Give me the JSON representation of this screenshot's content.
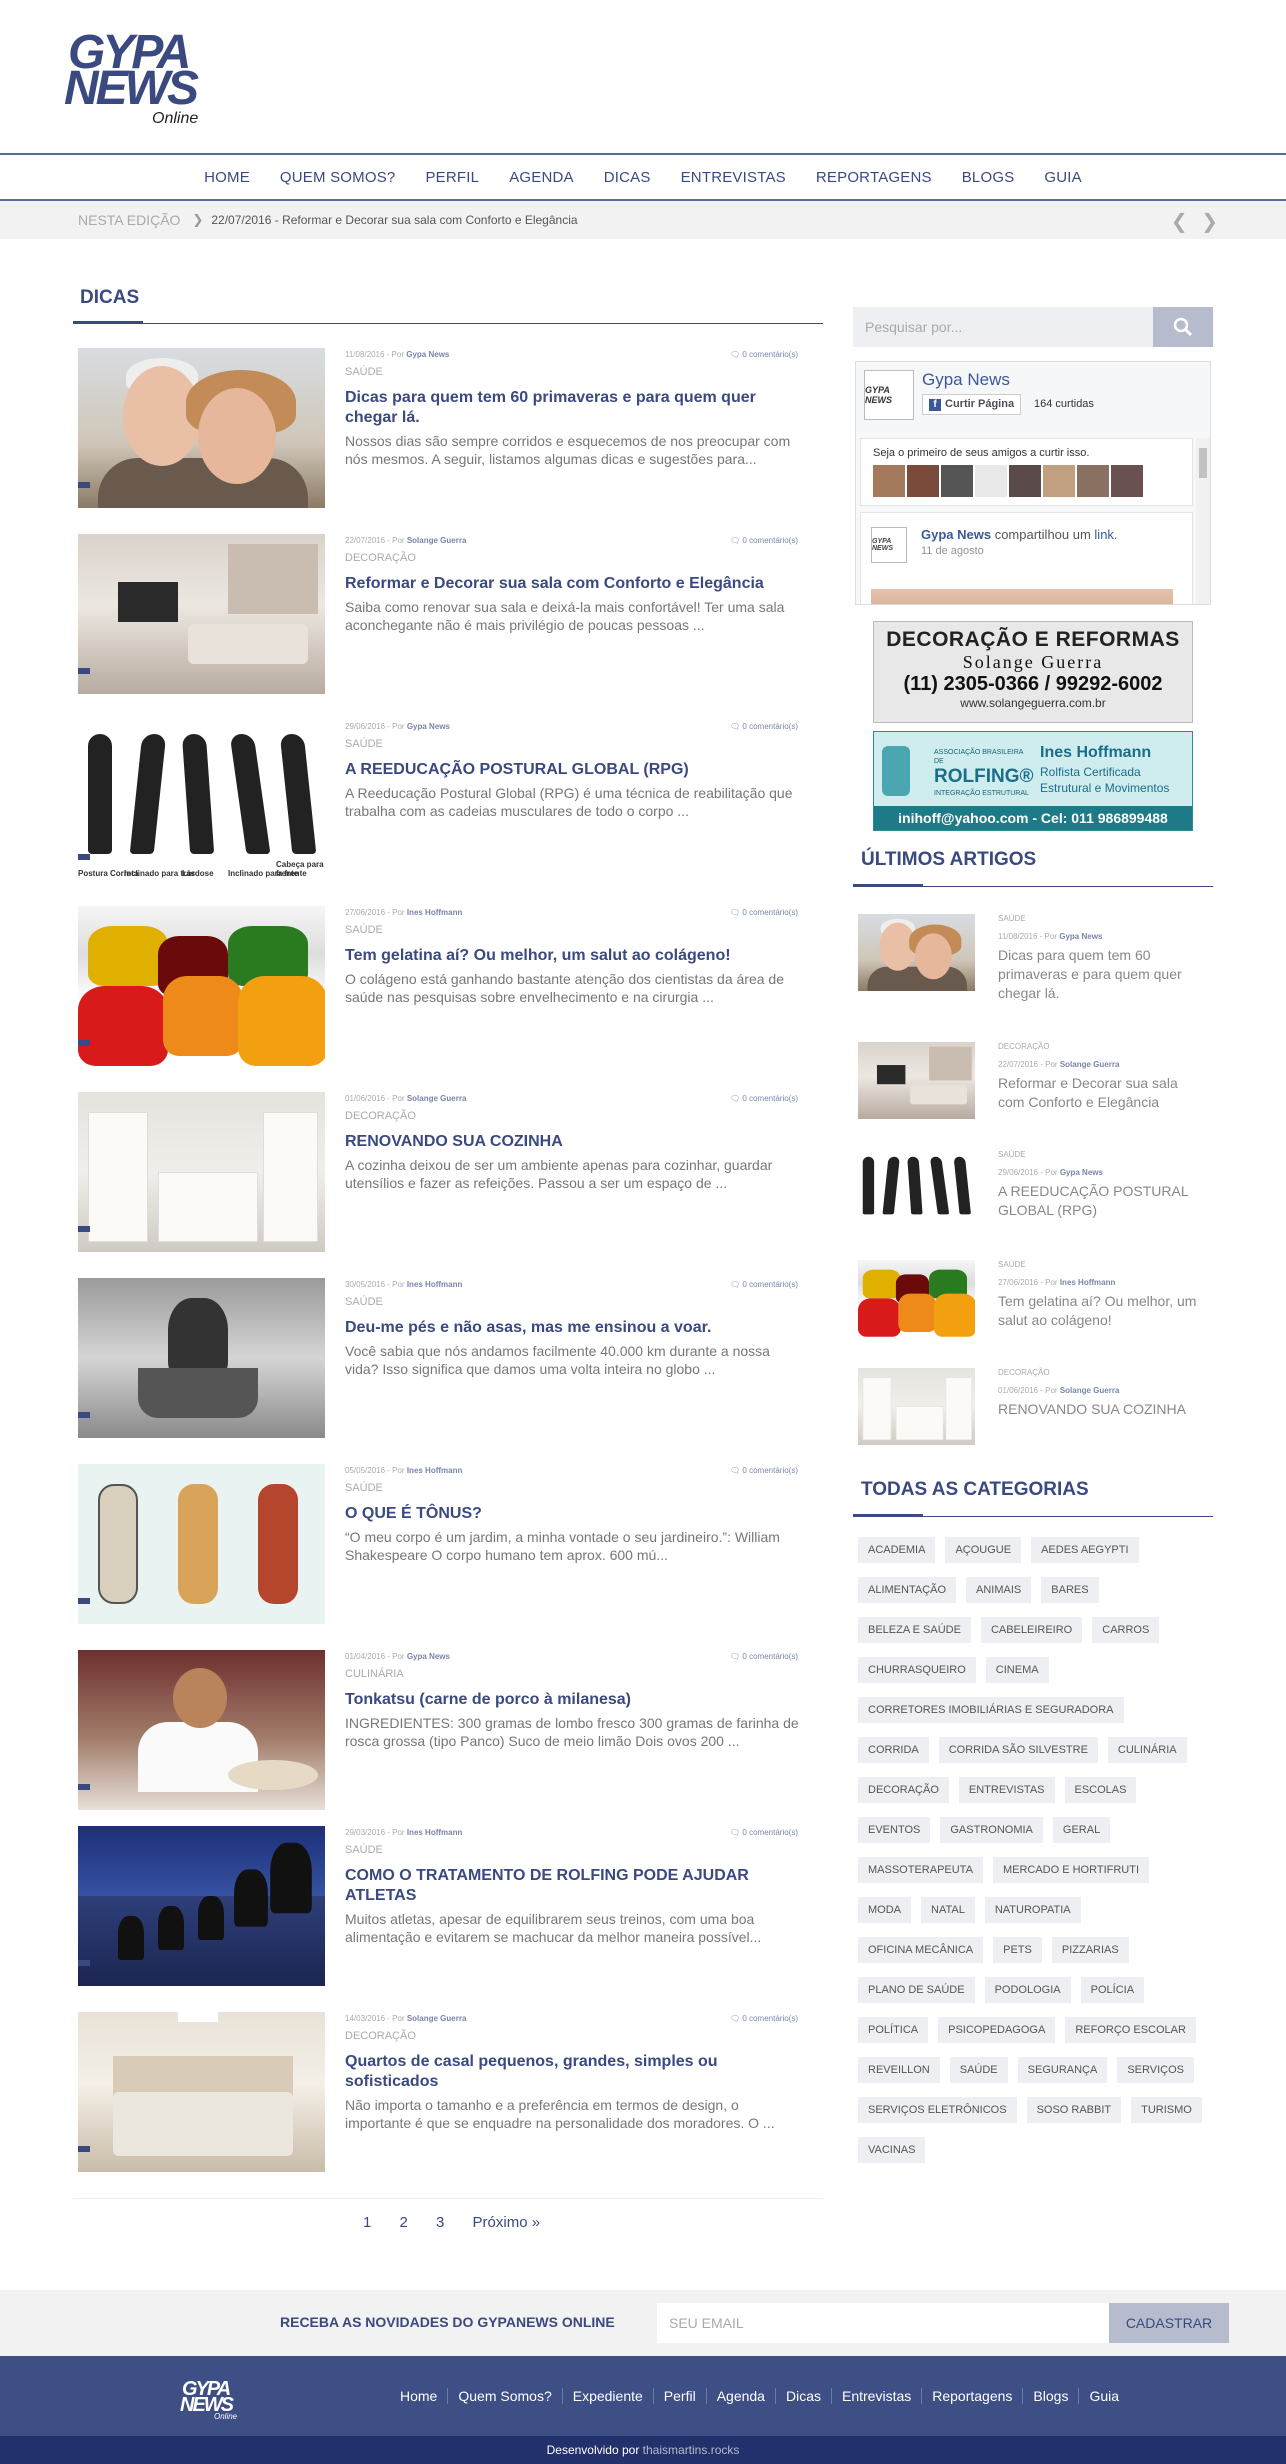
{
  "header": {
    "logo_line1": "GYPA",
    "logo_line2": "NEWS",
    "logo_line3": "Online"
  },
  "nav": [
    "HOME",
    "QUEM SOMOS?",
    "PERFIL",
    "AGENDA",
    "DICAS",
    "ENTREVISTAS",
    "REPORTAGENS",
    "BLOGS",
    "GUIA"
  ],
  "ticker": {
    "label": "NESTA EDIÇÃO",
    "text": "22/07/2016 - Reformar e Decorar sua sala com Conforto e Elegância",
    "arrows": "❮ ❯"
  },
  "main": {
    "section_title": "DICAS",
    "posts": [
      {
        "date": "11/08/2016 - Por ",
        "author": "Gypa News",
        "comments": "0 comentário(s)",
        "category": "SAÚDE",
        "title": "Dicas para quem tem 60 primaveras e para quem quer chegar lá.",
        "excerpt": "Nossos dias são sempre corridos e esquecemos de nos preocupar com nós mesmos. A seguir, listamos algumas dicas e sugestões para..."
      },
      {
        "date": "22/07/2016 - Por ",
        "author": "Solange Guerra",
        "comments": "0 comentário(s)",
        "category": "DECORAÇÃO",
        "title": "Reformar e Decorar sua sala com Conforto e Elegância",
        "excerpt": "Saiba como renovar sua sala e deixá-la mais confortável! Ter uma sala aconchegante não é mais privilégio de poucas pessoas ..."
      },
      {
        "date": "29/06/2016 - Por ",
        "author": "Gypa News",
        "comments": "0 comentário(s)",
        "category": "SAÚDE",
        "title": "A REEDUCAÇÃO POSTURAL GLOBAL (RPG)",
        "excerpt": "A Reeducação Postural Global (RPG) é uma técnica de reabilitação que trabalha com as cadeias musculares de todo o corpo ..."
      },
      {
        "date": "27/06/2016 - Por ",
        "author": "Ines Hoffmann",
        "comments": "0 comentário(s)",
        "category": "SAÚDE",
        "title": "Tem gelatina aí? Ou melhor, um salut ao colágeno!",
        "excerpt": "O colágeno está ganhando bastante atenção dos cientistas da área de saúde nas pesquisas sobre envelhecimento e na cirurgia ..."
      },
      {
        "date": "01/06/2016 - Por ",
        "author": "Solange Guerra",
        "comments": "0 comentário(s)",
        "category": "DECORAÇÃO",
        "title": "RENOVANDO SUA COZINHA",
        "excerpt": "A cozinha deixou de ser um ambiente apenas para cozinhar, guardar utensílios e fazer as refeições. Passou a ser um espaço de ..."
      },
      {
        "date": "30/05/2016 - Por ",
        "author": "Ines Hoffmann",
        "comments": "0 comentário(s)",
        "category": "SAÚDE",
        "title": "Deu-me pés e não asas, mas me ensinou a voar.",
        "excerpt": "Você sabia que nós andamos facilmente 40.000 km durante a nossa vida? Isso significa que damos uma volta inteira no globo ..."
      },
      {
        "date": "05/05/2016 - Por ",
        "author": "Ines Hoffmann",
        "comments": "0 comentário(s)",
        "category": "SAÚDE",
        "title": "O QUE É TÔNUS?",
        "excerpt": "“O meu corpo é um jardim, a minha vontade o seu jardineiro.”: William Shakespeare O corpo humano tem aprox. 600 mú..."
      },
      {
        "date": "01/04/2016 - Por ",
        "author": "Gypa News",
        "comments": "0 comentário(s)",
        "category": "CULINÁRIA",
        "title": "Tonkatsu (carne de porco à milanesa)",
        "excerpt": "INGREDIENTES: 300 gramas de lombo fresco 300 gramas de farinha de rosca grossa (tipo Panco) Suco de meio limão Dois ovos 200 ..."
      },
      {
        "date": "29/03/2016 - Por ",
        "author": "Ines Hoffmann",
        "comments": "0 comentário(s)",
        "category": "SAÚDE",
        "title": "COMO O TRATAMENTO DE ROLFING PODE AJUDAR ATLETAS",
        "excerpt": "Muitos atletas, apesar de equilibrarem seus treinos, com uma boa alimentação e evitarem se machucar da melhor maneira possível..."
      },
      {
        "date": "14/03/2016 - Por ",
        "author": "Solange Guerra",
        "comments": "0 comentário(s)",
        "category": "DECORAÇÃO",
        "title": "Quartos de casal pequenos, grandes, simples ou sofisticados",
        "excerpt": "Não importa o tamanho e a preferência em termos de design, o importante é que se enquadre na personalidade dos moradores. O ..."
      }
    ],
    "posture_labels": [
      "Postura Correta",
      "Inclinado para trás",
      "Lordose",
      "Inclinado para frente",
      "Cabeça para frente"
    ],
    "pagination": {
      "p1": "1",
      "p2": "2",
      "p3": "3",
      "next": "Próximo  »"
    }
  },
  "sidebar": {
    "search_placeholder": "Pesquisar por...",
    "facebook": {
      "logo_text": "GYPA NEWS",
      "page_name": "Gypa News",
      "like_label": "Curtir Página",
      "likes": "164 curtidas",
      "friends_text": "Seja o primeiro de seus amigos a curtir isso.",
      "share_author": "Gypa News",
      "share_verb": " compartilhou um ",
      "share_link": "link.",
      "share_date": "11 de agosto"
    },
    "ad1": {
      "line1": "DECORAÇÃO E REFORMAS",
      "line2": "Solange Guerra",
      "line3": "(11) 2305-0366 / 99292-6002",
      "line4": "www.solangeguerra.com.br"
    },
    "ad2": {
      "assoc": "ASSOCIAÇÃO BRASILEIRA DE",
      "brand": "ROLFING®",
      "integ": "INTEGRAÇÃO ESTRUTURAL",
      "name": "Ines Hoffmann",
      "sub1": "Rolfista Certificada",
      "sub2": "Estrutural e Movimentos",
      "contact": "inihoff@yahoo.com - Cel: 011 986899488"
    },
    "latest_title": "ÚLTIMOS ARTIGOS",
    "latest": [
      {
        "category": "SAÚDE",
        "date": "11/08/2016 - Por ",
        "author": "Gypa News",
        "title": "Dicas para quem tem 60 primaveras e para quem quer chegar lá."
      },
      {
        "category": "DECORAÇÃO",
        "date": "22/07/2016 - Por ",
        "author": "Solange Guerra",
        "title": "Reformar e Decorar sua sala com Conforto e Elegância"
      },
      {
        "category": "SAÚDE",
        "date": "29/06/2016 - Por ",
        "author": "Gypa News",
        "title": "A REEDUCAÇÃO POSTURAL GLOBAL (RPG)"
      },
      {
        "category": "SAÚDE",
        "date": "27/06/2016 - Por ",
        "author": "Ines Hoffmann",
        "title": "Tem gelatina aí? Ou melhor, um salut ao colágeno!"
      },
      {
        "category": "DECORAÇÃO",
        "date": "01/06/2016 - Por ",
        "author": "Solange Guerra",
        "title": "RENOVANDO SUA COZINHA"
      }
    ],
    "categories_title": "TODAS AS CATEGORIAS",
    "categories": [
      "ACADEMIA",
      "AÇOUGUE",
      "AEDES AEGYPTI",
      "ALIMENTAÇÃO",
      "ANIMAIS",
      "BARES",
      "BELEZA E SAÚDE",
      "CABELEIREIRO",
      "CARROS",
      "CHURRASQUEIRO",
      "CINEMA",
      "CORRETORES IMOBILIÁRIAS E SEGURADORA",
      "CORRIDA",
      "CORRIDA SÃO SILVESTRE",
      "CULINÁRIA",
      "DECORAÇÃO",
      "ENTREVISTAS",
      "ESCOLAS",
      "EVENTOS",
      "GASTRONOMIA",
      "GERAL",
      "MASSOTERAPEUTA",
      "MERCADO E HORTIFRUTI",
      "MODA",
      "NATAL",
      "NATUROPATIA",
      "OFICINA MECÂNICA",
      "PETS",
      "PIZZARIAS",
      "PLANO DE SAÚDE",
      "PODOLOGIA",
      "POLÍCIA",
      "POLÍTICA",
      "PSICOPEDAGOGA",
      "REFORÇO ESCOLAR",
      "REVEILLON",
      "SAÚDE",
      "SEGURANÇA",
      "SERVIÇOS",
      "SERVIÇOS ELETRÔNICOS",
      "SOSO RABBIT",
      "TURISMO",
      "VACINAS"
    ]
  },
  "newsletter": {
    "label": "RECEBA AS NOVIDADES DO GYPANEWS ONLINE",
    "placeholder": "SEU EMAIL",
    "button": "CADASTRAR"
  },
  "footer": {
    "logo_line1": "GYPA",
    "logo_line2": "NEWS",
    "logo_line3": "Online",
    "links": [
      "Home",
      "Quem Somos?",
      "Expediente",
      "Perfil",
      "Agenda",
      "Dicas",
      "Entrevistas",
      "Reportagens",
      "Blogs",
      "Guia"
    ]
  },
  "credits": {
    "prefix": "Desenvolvido por ",
    "dev": "thaismartins.rocks"
  },
  "colors": {
    "brand": "#3a4a80",
    "footer": "#3e4f86",
    "credits_bar": "#22306b",
    "button": "#b6bccd"
  }
}
